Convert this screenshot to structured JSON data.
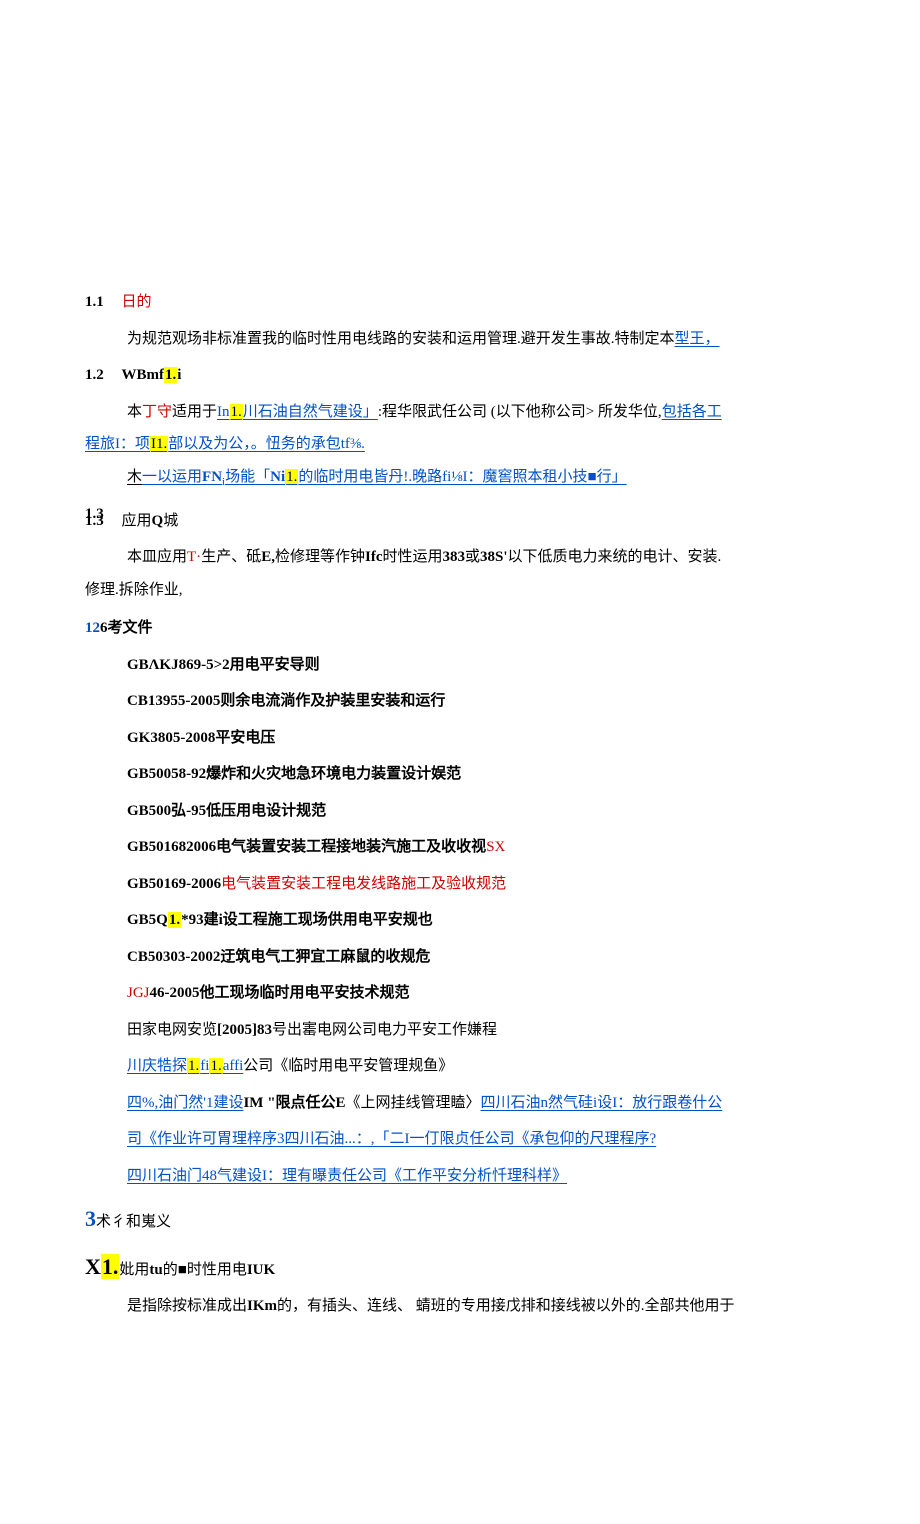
{
  "h11_num": "1.1",
  "h11_title": "日的",
  "p11": "为规范观场非标准置我的临时性用电线路的安装和运用管理.避开发生事故.特制定本",
  "p11_link": "型王，",
  "h12_num": "1.2",
  "h12_title_a": "WBmf",
  "h12_title_b": "1.",
  "h12_title_c": "i",
  "p12a_pre": "本",
  "p12a_red1": "丁守",
  "p12a_mid": "适用于",
  "p12a_link1a": "In",
  "p12a_link1b": "1.",
  "p12a_link1c": "川石油自然气建设」",
  "p12a_after": ":程华限武任公司  (以下他称公司> 所发华位,",
  "p12a_tail": "包括各工",
  "p12b_a": "程旅I：项",
  "p12b_b": "I1.",
  "p12b_c": "部以及为公，。忸务的承包tf⅜.",
  "p12c_pre": "木",
  "p12c_body_a": "一以运用",
  "p12c_fn": "FN",
  "p12c_sub": "i",
  "p12c_body_b": "场能「",
  "p12c_ni": "Ni",
  "p12c_mark": "1.",
  "p12c_body_c": "的临时用电皆丹!.晚路fi⅛I：魔窖照本租小技",
  "p12c_sq": "■",
  "p12c_body_d": "行」",
  "h13_num": "1.3",
  "h13_title": "应用Q城",
  "p13a_a": "本皿应用",
  "p13a_b": "T·",
  "p13a_c": "生产、砥",
  "p13a_d": "E,",
  "p13a_e": "检修理等作钟",
  "p13a_f": "Ifc",
  "p13a_g": "时性运用",
  "p13a_h": "383",
  "p13a_i": "或",
  "p13a_j": "38S'",
  "p13a_k": "以下低质电力来统的电计、安装.",
  "p13b": "修理.拆除作业,",
  "ref_head_a": "12",
  "ref_head_b": "6",
  "ref_head_c": "考文件",
  "r1": "GBΛKJ869-5>2用电平安导则",
  "r2": "CB13955-2005则余电流淌作及护装里安装和运行",
  "r3": "GK3805-2008平安电压",
  "r4": "GB50058-92爆炸和火灾地急环境电力装置设计娱范",
  "r5": "GB500弘-95低压用电设计规范",
  "r6a": "GB501682006电气装置安装工程接地装汽施工及收收视",
  "r6b": "SX",
  "r7a": "GB50169-2006",
  "r7b": "电气装置安装工程电发线路施工及验收规范",
  "r8a": "GB5Q",
  "r8b": "1.",
  "r8c": "*93建i设工程施工现场供用电平安规也",
  "r9": "CB50303-2002迂筑电气工狎宜工麻鼠的收规危",
  "r10a": "JGJ",
  "r10b": "46-2005他工现场临时用电平安技术规范",
  "r11a": "田家电网安览",
  "r11b": "[2005]83",
  "r11c": "号出寚电网公司电力平安工作嫌程",
  "r12a": "川庆牿探",
  "r12b": "1.",
  "r12c": "fi",
  "r12d": "1.",
  "r12e": "affi",
  "r12f": "公司《临时用电平安管理规鱼》",
  "r13a": "四%,油门然'1建设",
  "r13b": "IM \"限点任公E",
  "r13c": "《上网挂线管理瞌〉",
  "r13d": "四川石油n然气硅i设I：放行跟卷什公",
  "r14a": "司《作业许可胃理梓序3",
  "r14b": "四川石油...：,「二I一仃限贞任公司《承包仰的尺理程序?",
  "r15": "四川石油门48气建设I：理有曝责任公司《工作平安分析忏理科样》",
  "sec3_a": "3",
  "sec3_b": "术彳和嵬义",
  "x1_a": "X",
  "x1_b": "1.",
  "x1_c": "妣用",
  "x1_d": "tu",
  "x1_e": "的",
  "x1_sq": "■",
  "x1_f": "时性用电",
  "x1_g": "IUK",
  "x1p_a": "是指除按标准成出",
  "x1p_b": "IKm",
  "x1p_c": "的，有插头、连线、 蜻班的专用接戊排和接线被以外的.全部共他用于"
}
